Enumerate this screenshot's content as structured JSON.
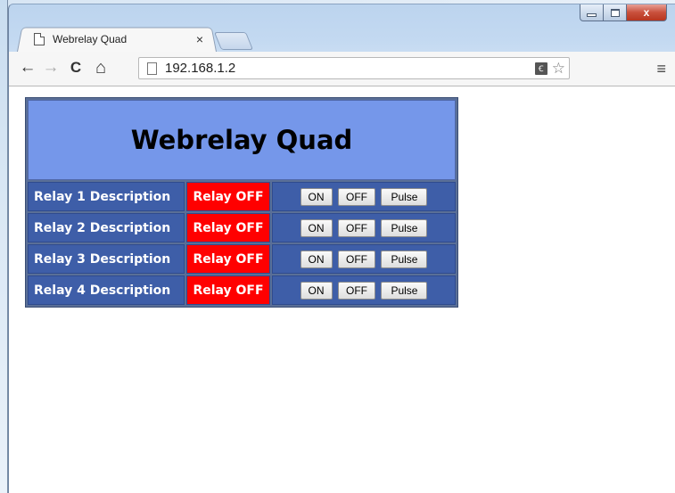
{
  "window": {
    "minimize_icon": "minimize-icon",
    "maximize_icon": "maximize-icon",
    "close_icon": "close-icon",
    "close_glyph": "x"
  },
  "tab": {
    "title": "Webrelay Quad",
    "close_glyph": "×"
  },
  "toolbar": {
    "back_glyph": "←",
    "forward_glyph": "→",
    "reload_glyph": "C",
    "home_glyph": "⌂",
    "url": "192.168.1.2",
    "translate_glyph": "Ꞓ",
    "star_glyph": "☆",
    "menu_glyph": "≡"
  },
  "page": {
    "heading": "Webrelay Quad",
    "relays": [
      {
        "description": "Relay 1 Description",
        "status": "Relay OFF",
        "on_label": "ON",
        "off_label": "OFF",
        "pulse_label": "Pulse"
      },
      {
        "description": "Relay 2 Description",
        "status": "Relay OFF",
        "on_label": "ON",
        "off_label": "OFF",
        "pulse_label": "Pulse"
      },
      {
        "description": "Relay 3 Description",
        "status": "Relay OFF",
        "on_label": "ON",
        "off_label": "OFF",
        "pulse_label": "Pulse"
      },
      {
        "description": "Relay 4 Description",
        "status": "Relay OFF",
        "on_label": "ON",
        "off_label": "OFF",
        "pulse_label": "Pulse"
      }
    ]
  },
  "colors": {
    "header_bg": "#7597ea",
    "row_bg": "#3e5ea8",
    "status_off_bg": "#ff0000"
  }
}
